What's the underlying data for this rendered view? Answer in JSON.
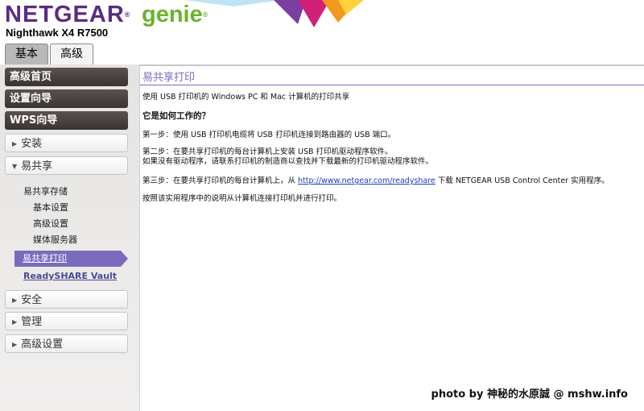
{
  "header": {
    "brand": "NETGEAR",
    "brand_reg": "®",
    "product": "genie",
    "product_reg": "®",
    "model": "Nighthawk X4 R7500"
  },
  "tabs": [
    {
      "label": "基本"
    },
    {
      "label": "高级"
    }
  ],
  "sidebar": {
    "home": "高级首页",
    "wizard": "设置向导",
    "wps": "WPS向导",
    "install": "安装",
    "readyshare": "易共享",
    "sub_storage": "易共享存储",
    "sub_basic": "基本设置",
    "sub_advanced": "高级设置",
    "sub_media": "媒体服务器",
    "sub_printer": "易共享打印",
    "sub_vault": "ReadySHARE Vault",
    "security": "安全",
    "admin": "管理",
    "advanced_setup": "高级设置"
  },
  "content": {
    "title": "易共享打印",
    "intro": "使用 USB 打印机的 Windows PC 和 Mac 计算机的打印共享",
    "how_heading": "它是如何工作的？",
    "step1": "第一步：使用 USB 打印机电缆将 USB 打印机连接到路由器的 USB 端口。",
    "step2a": "第二步：在要共享打印机的每台计算机上安装 USB 打印机驱动程序软件。",
    "step2b": "如果没有驱动程序，请联系打印机的制造商以查找并下载最新的打印机驱动程序软件。",
    "step3_pre": "第三步：在要共享打印机的每台计算机上，从 ",
    "step3_link": "http://www.netgear.com/readyshare",
    "step3_post": " 下载 NETGEAR USB Control Center 实用程序。",
    "final": "按照该实用程序中的说明从计算机连接打印机并进行打印。"
  },
  "watermark": "photo by 神秘的水原誠 @ mshw.info",
  "colors": {
    "brand_purple": "#5a2c82",
    "genie_green": "#6ab42d",
    "accent_purple": "#7b6bbf",
    "link_blue": "#1a3fbf"
  }
}
